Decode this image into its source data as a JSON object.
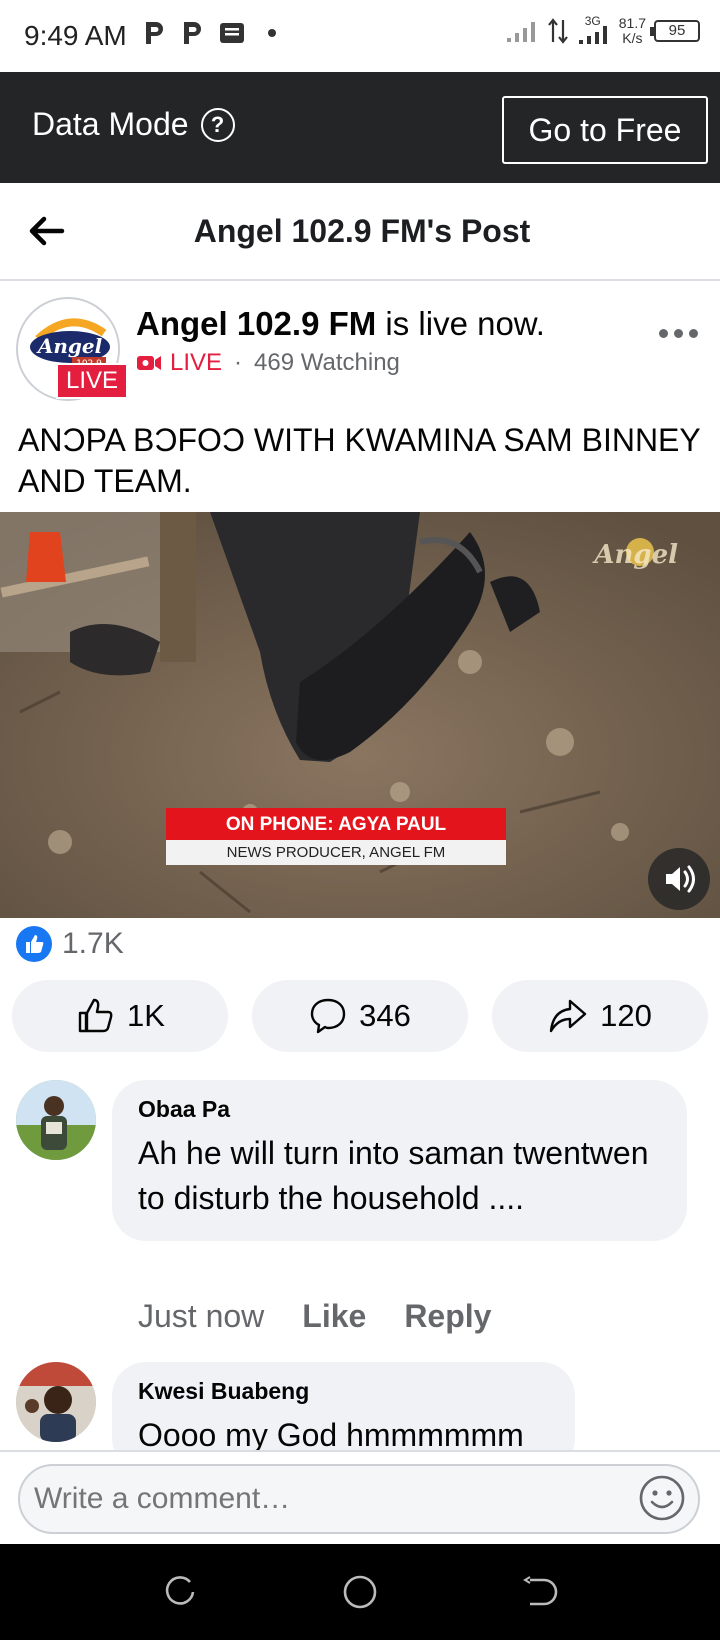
{
  "status_bar": {
    "time": "9:49 AM",
    "network": "3G",
    "speed_value": "81.7",
    "speed_unit": "K/s",
    "battery": "95"
  },
  "data_mode": {
    "label": "Data Mode",
    "help_icon": "?",
    "button": "Go to Free"
  },
  "header": {
    "title": "Angel 102.9 FM's Post"
  },
  "post": {
    "page_name": "Angel 102.9 FM",
    "status_suffix": " is live now.",
    "live_badge": "LIVE",
    "live_label": "LIVE",
    "separator": "·",
    "watching": "469 Watching",
    "text": "ANƆPA BƆFOƆ WITH KWAMINA SAM BINNEY AND TEAM.",
    "video": {
      "lower_third_title": "ON PHONE: AGYA PAUL",
      "lower_third_sub": "NEWS PRODUCER, ANGEL FM",
      "watermark": "Angel"
    },
    "reaction_count": "1.7K",
    "actions": {
      "like": "1K",
      "comment": "346",
      "share": "120"
    }
  },
  "comments": [
    {
      "author": "Obaa Pa",
      "text": "Ah he will turn into saman twentwen to disturb the household ....",
      "time": "Just now",
      "like": "Like",
      "reply": "Reply"
    },
    {
      "author": "Kwesi Buabeng",
      "text": "Oooo my God hmmmmmm"
    }
  ],
  "composer": {
    "placeholder": "Write a comment…"
  },
  "avatar_logo": {
    "brand": "Angel",
    "freq": "102.9"
  },
  "colors": {
    "accent_blue": "#1877f2",
    "live_red": "#e41e3f",
    "data_bar": "#242526"
  }
}
